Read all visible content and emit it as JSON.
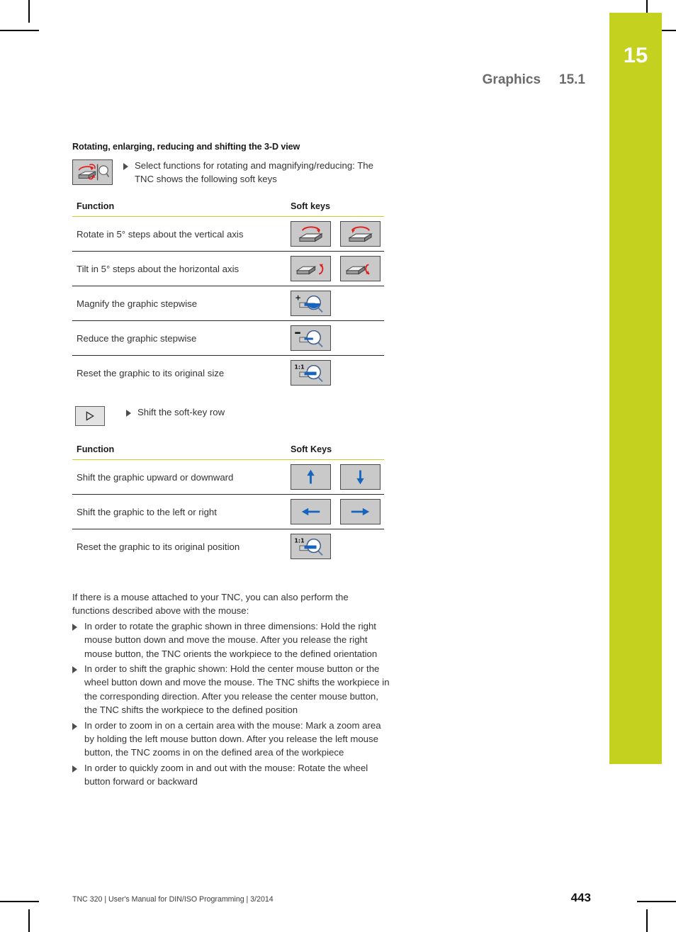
{
  "page": {
    "chapter_number": "15",
    "running_head_title": "Graphics",
    "running_head_section": "15.1",
    "page_number": "443",
    "footer_imprint": "TNC 320 | User's Manual for DIN/ISO Programming | 3/2014",
    "accent_color": "#c4d11e",
    "rule_color": "#c9d21e"
  },
  "section": {
    "title": "Rotating, enlarging, reducing and shifting the 3-D view",
    "intro_step": "Select functions for rotating and magnifying/reducing: The TNC shows the following soft keys",
    "intro_step_icon": "rotate-magnify-icon"
  },
  "table1": {
    "header_function": "Function",
    "header_softkeys": "Soft keys",
    "rows": [
      {
        "function": "Rotate in 5° steps about the vertical axis",
        "keys": [
          "rotate-vertical-ccw-key",
          "rotate-vertical-cw-key"
        ]
      },
      {
        "function": "Tilt in 5° steps about the horizontal axis",
        "keys": [
          "tilt-horizontal-up-key",
          "tilt-horizontal-down-key"
        ]
      },
      {
        "function": "Magnify the graphic stepwise",
        "keys": [
          "zoom-in-key"
        ],
        "key_labels": [
          "+"
        ]
      },
      {
        "function": "Reduce the graphic stepwise",
        "keys": [
          "zoom-out-key"
        ],
        "key_labels": [
          "–"
        ]
      },
      {
        "function": "Reset the graphic to its original size",
        "keys": [
          "zoom-reset-size-key"
        ],
        "key_labels": [
          "1:1"
        ]
      }
    ]
  },
  "shift_row_step": {
    "label": "Shift the soft-key row",
    "icon": "shift-softkey-row-key"
  },
  "table2": {
    "header_function": "Function",
    "header_softkeys": "Soft Keys",
    "rows": [
      {
        "function": "Shift the graphic upward or downward",
        "keys": [
          "arrow-up-key",
          "arrow-down-key"
        ]
      },
      {
        "function": "Shift the graphic to the left or right",
        "keys": [
          "arrow-left-key",
          "arrow-right-key"
        ]
      },
      {
        "function": "Reset the graphic to its original position",
        "keys": [
          "zoom-reset-position-key"
        ],
        "key_labels": [
          "1:1"
        ]
      }
    ]
  },
  "mouse_section": {
    "intro": "If there is a mouse attached to your TNC, you can also perform the functions described above with the mouse:",
    "bullets": [
      "In order to rotate the graphic shown in three dimensions: Hold the right mouse button down and move the mouse. After you release the right mouse button, the TNC orients the workpiece to the defined orientation",
      "In order to shift the graphic shown: Hold the center mouse button or the wheel button down and move the mouse. The TNC shifts the workpiece in the corresponding direction. After you release the center mouse button, the TNC shifts the workpiece to the defined position",
      "In order to zoom in on a certain area with the mouse: Mark a zoom area by holding the left mouse button down. After you release the left mouse button, the TNC zooms in on the defined area of the workpiece",
      "In order to quickly zoom in and out with the mouse: Rotate the wheel button forward or backward"
    ]
  }
}
